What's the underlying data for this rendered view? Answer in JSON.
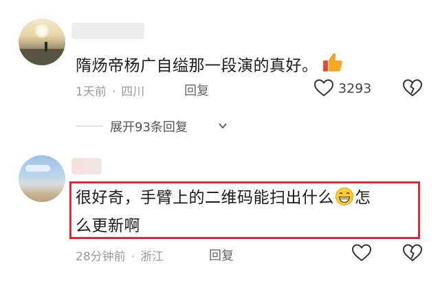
{
  "comments": [
    {
      "avatar": "sunset-landscape-avatar",
      "text": "隋炀帝杨广自缢那一段演的真好。",
      "emoji": "thumbs-up-icon",
      "time": "1天前",
      "location": "四川",
      "reply_label": "回复",
      "likes": "3293",
      "expand_replies": "展开93条回复"
    },
    {
      "avatar": "beach-sky-avatar",
      "text_line1": "很好奇，手臂上的二维码能扫出什么",
      "emoji": "grinning-face-icon",
      "text_line1_tail": "怎",
      "text_line2": "么更新啊",
      "time": "28分钟前",
      "location": "浙江",
      "reply_label": "回复"
    }
  ],
  "colors": {
    "highlight": "#e0292f",
    "meta": "#9a9a9a",
    "text": "#1a1a1a"
  },
  "separator": "·"
}
